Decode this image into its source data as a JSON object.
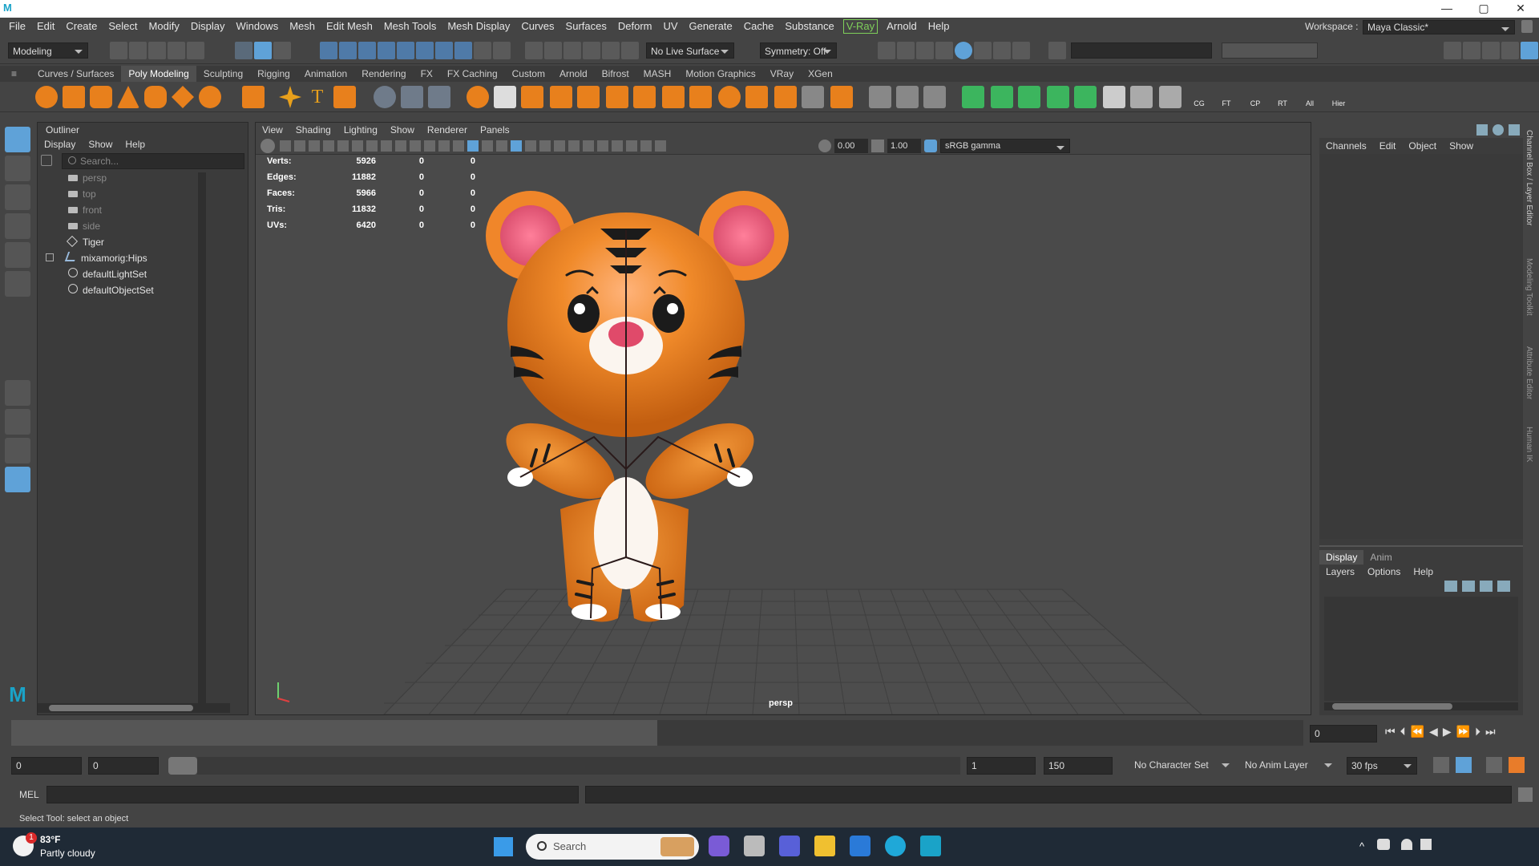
{
  "window": {
    "app_logo": "M",
    "controls": [
      "—",
      "▢",
      "✕"
    ]
  },
  "menu": [
    "File",
    "Edit",
    "Create",
    "Select",
    "Modify",
    "Display",
    "Windows",
    "Mesh",
    "Edit Mesh",
    "Mesh Tools",
    "Mesh Display",
    "Curves",
    "Surfaces",
    "Deform",
    "UV",
    "Generate",
    "Cache",
    "Substance",
    "V-Ray",
    "Arnold",
    "Help"
  ],
  "workspace": {
    "label": "Workspace :",
    "value": "Maya Classic*"
  },
  "status": {
    "mode": "Modeling",
    "live_surface": "No Live Surface",
    "symmetry": "Symmetry: Off"
  },
  "shelf_tabs": [
    "Curves / Surfaces",
    "Poly Modeling",
    "Sculpting",
    "Rigging",
    "Animation",
    "Rendering",
    "FX",
    "FX Caching",
    "Custom",
    "Arnold",
    "Bifrost",
    "MASH",
    "Motion Graphics",
    "VRay",
    "XGen"
  ],
  "shelf_active": "Poly Modeling",
  "shelf_labels": [
    "CG",
    "FT",
    "CP",
    "RT",
    "All",
    "Hier"
  ],
  "outliner": {
    "title": "Outliner",
    "menu": [
      "Display",
      "Show",
      "Help"
    ],
    "search_placeholder": "Search...",
    "items": [
      {
        "label": "persp",
        "dim": true
      },
      {
        "label": "top",
        "dim": true
      },
      {
        "label": "front",
        "dim": true
      },
      {
        "label": "side",
        "dim": true
      },
      {
        "label": "Tiger",
        "dim": false
      },
      {
        "label": "mixamorig:Hips",
        "dim": false
      },
      {
        "label": "defaultLightSet",
        "dim": false
      },
      {
        "label": "defaultObjectSet",
        "dim": false
      }
    ]
  },
  "viewport": {
    "menu": [
      "View",
      "Shading",
      "Lighting",
      "Show",
      "Renderer",
      "Panels"
    ],
    "field1": "0.00",
    "field2": "1.00",
    "colorspace": "sRGB gamma",
    "camera": "persp",
    "hud": [
      {
        "label": "Verts:",
        "v": "5926",
        "a": "0",
        "b": "0"
      },
      {
        "label": "Edges:",
        "v": "11882",
        "a": "0",
        "b": "0"
      },
      {
        "label": "Faces:",
        "v": "5966",
        "a": "0",
        "b": "0"
      },
      {
        "label": "Tris:",
        "v": "11832",
        "a": "0",
        "b": "0"
      },
      {
        "label": "UVs:",
        "v": "6420",
        "a": "0",
        "b": "0"
      }
    ]
  },
  "channel_box": {
    "menu": [
      "Channels",
      "Edit",
      "Object",
      "Show"
    ]
  },
  "layer_editor": {
    "tabs": [
      "Display",
      "Anim"
    ],
    "menu": [
      "Layers",
      "Options",
      "Help"
    ]
  },
  "side_tabs": [
    "Channel Box / Layer Editor",
    "Modeling Toolkit",
    "Attribute Editor",
    "Human IK"
  ],
  "timeline": {
    "start_label": "0",
    "start_value": "0",
    "tick": "1",
    "current": "0"
  },
  "range": {
    "start": "0",
    "start2": "0",
    "range_start": "1",
    "range_end": "150",
    "character": "No Character Set",
    "anim_layer": "No Anim Layer",
    "fps": "30 fps"
  },
  "mel": {
    "label": "MEL"
  },
  "help_line": "Select Tool: select an object",
  "taskbar": {
    "temp": "83°F",
    "weather": "Partly cloudy",
    "search": "Search",
    "badge": "1"
  },
  "colors": {
    "orange": "#e8801c",
    "accent": "#5fa2d8"
  }
}
